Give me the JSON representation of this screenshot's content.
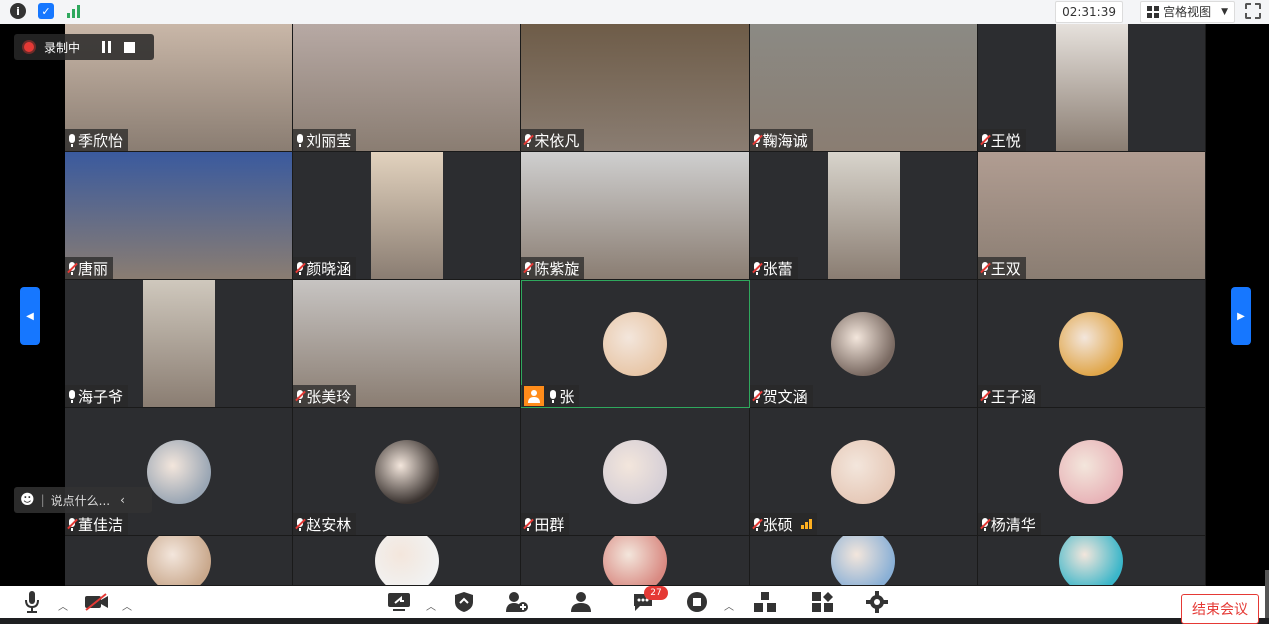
{
  "topbar": {
    "timer": "02:31:39",
    "view_label": "宫格视图"
  },
  "recording": {
    "label": "录制中"
  },
  "participants": [
    {
      "name": "季欣怡",
      "muted": false,
      "kind": "video",
      "bg": "#c9b7a8",
      "video_w": 228
    },
    {
      "name": "刘丽莹",
      "muted": false,
      "kind": "video",
      "bg": "#b7a9a4",
      "video_w": 228
    },
    {
      "name": "宋依凡",
      "muted": true,
      "kind": "video",
      "bg": "#6e5c48",
      "video_w": 228
    },
    {
      "name": "鞠海诚",
      "muted": true,
      "kind": "video",
      "bg": "#8b8a84",
      "video_w": 228
    },
    {
      "name": "王悦",
      "muted": true,
      "kind": "video",
      "bg": "#e6e1dc",
      "video_w": 72
    },
    {
      "name": "唐丽",
      "muted": true,
      "kind": "video",
      "bg": "#3a5a9e",
      "video_w": 228
    },
    {
      "name": "颜晓涵",
      "muted": true,
      "kind": "video",
      "bg": "#e2d2be",
      "video_w": 72
    },
    {
      "name": "陈紫旋",
      "muted": true,
      "kind": "video",
      "bg": "#cfcfcf",
      "video_w": 228
    },
    {
      "name": "张蕾",
      "muted": true,
      "kind": "video",
      "bg": "#d8d4cc",
      "video_w": 72
    },
    {
      "name": "王双",
      "muted": true,
      "kind": "video",
      "bg": "#b19d92",
      "video_w": 228
    },
    {
      "name": "海子爷",
      "muted": false,
      "kind": "video",
      "bg": "#cfc8bd",
      "video_w": 72
    },
    {
      "name": "张美玲",
      "muted": true,
      "kind": "video",
      "bg": "#c7c4c2",
      "video_w": 228
    },
    {
      "name": "张",
      "muted": false,
      "kind": "avatar",
      "bg": "#e8c7a8",
      "host": true,
      "active": true
    },
    {
      "name": "贺文涵",
      "muted": true,
      "kind": "avatar",
      "bg": "#7a6a62"
    },
    {
      "name": "王子涵",
      "muted": true,
      "kind": "avatar",
      "bg": "#e0a64a"
    },
    {
      "name": "董佳洁",
      "muted": true,
      "kind": "avatar",
      "bg": "#9aa6b4"
    },
    {
      "name": "赵安林",
      "muted": true,
      "kind": "avatar",
      "bg": "#3a3330"
    },
    {
      "name": "田群",
      "muted": true,
      "kind": "avatar",
      "bg": "#d6cfd6"
    },
    {
      "name": "张硕",
      "muted": true,
      "kind": "avatar",
      "bg": "#e6c9b8",
      "signal": true
    },
    {
      "name": "杨清华",
      "muted": true,
      "kind": "avatar",
      "bg": "#e8b4b8"
    },
    {
      "name": "",
      "muted": false,
      "kind": "avatar",
      "bg": "#c9a88c"
    },
    {
      "name": "",
      "muted": false,
      "kind": "avatar",
      "bg": "#f2f2f2"
    },
    {
      "name": "",
      "muted": false,
      "kind": "avatar",
      "bg": "#d98a82"
    },
    {
      "name": "",
      "muted": false,
      "kind": "avatar",
      "bg": "#8ab0d6"
    },
    {
      "name": "",
      "muted": false,
      "kind": "avatar",
      "bg": "#3bb6c9"
    }
  ],
  "chat": {
    "placeholder": "说点什么..."
  },
  "toolbar": {
    "chat_badge": "27",
    "end_label": "结束会议"
  }
}
